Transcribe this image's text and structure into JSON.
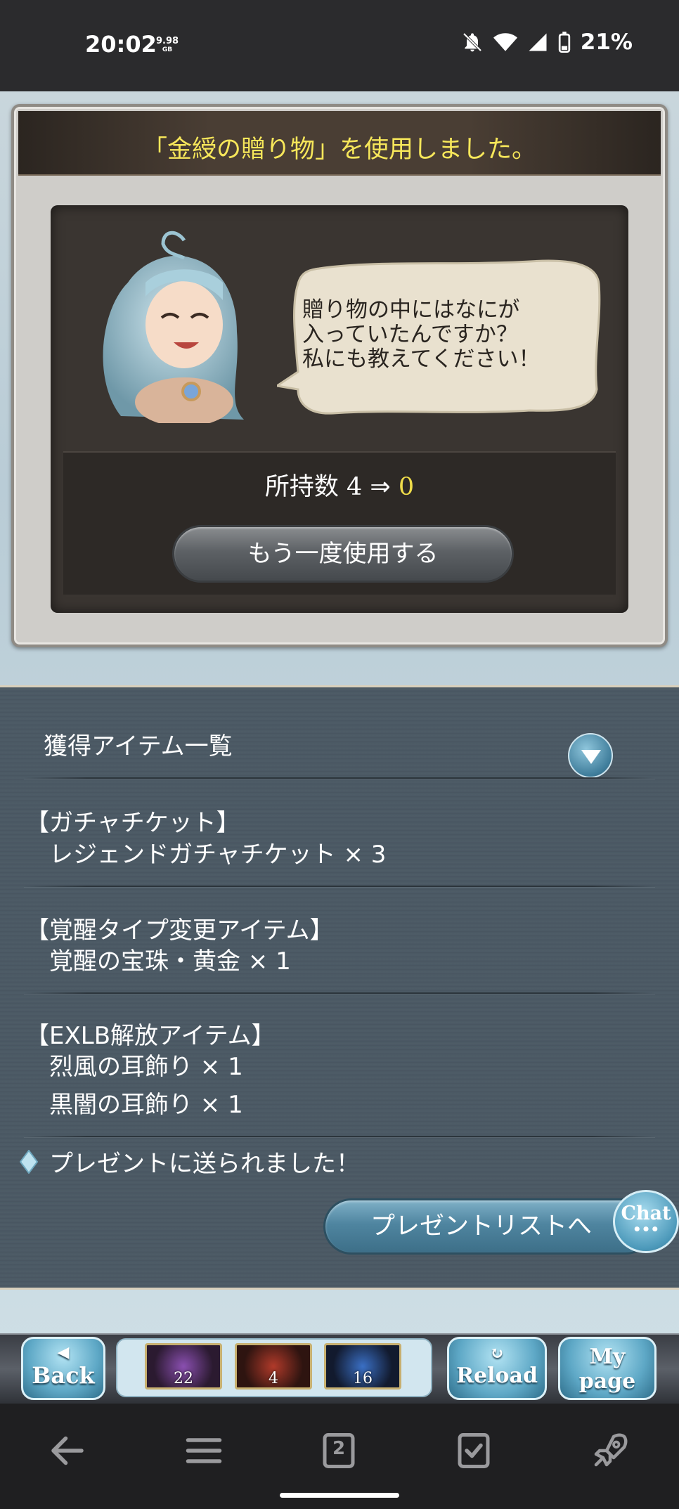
{
  "status_bar": {
    "time": "20:02",
    "memory_value": "9.98",
    "memory_unit": "GB",
    "battery_percent": "21%"
  },
  "dialog": {
    "title": "「金綬の贈り物」を使用しました。",
    "speech_lines": [
      "贈り物の中にはなにが",
      "入っていたんですか？",
      "私にも教えてください！"
    ],
    "count_label": "所持数",
    "count_before": "4",
    "count_arrow": "⇒",
    "count_after": "0",
    "use_again_label": "もう一度使用する"
  },
  "items_panel": {
    "header": "獲得アイテム一覧",
    "groups": [
      {
        "category": "【ガチャチケット】",
        "items": [
          "レジェンドガチャチケット × 3"
        ]
      },
      {
        "category": "【覚醒タイプ変更アイテム】",
        "items": [
          "覚醒の宝珠・黄金 × 1"
        ]
      },
      {
        "category": "【EXLB解放アイテム】",
        "items": [
          "烈風の耳飾り × 1",
          "黒闇の耳飾り × 1"
        ]
      }
    ],
    "notice": "プレゼントに送られました！",
    "present_list_button": "プレゼントリストへ",
    "chat_label": "Chat"
  },
  "game_nav": {
    "back_label": "Back",
    "reload_label": "Reload",
    "mypage_label_1": "My",
    "mypage_label_2": "page",
    "thumbs": [
      {
        "count": "22",
        "color": "#8a4fb0"
      },
      {
        "count": "4",
        "color": "#b03a2a"
      },
      {
        "count": "16",
        "color": "#3a6fc4"
      }
    ]
  },
  "android_nav": {
    "tab_count": "2"
  }
}
